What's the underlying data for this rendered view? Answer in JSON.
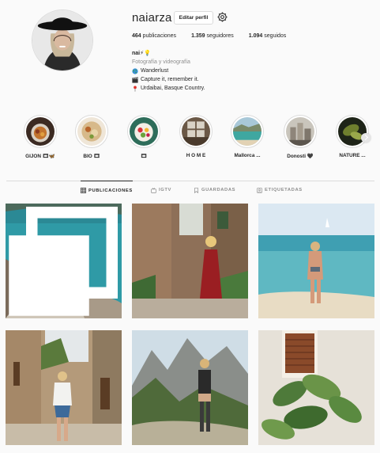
{
  "profile": {
    "username": "naiarza",
    "edit_label": "Editar perfil",
    "stats": {
      "posts_count": "464",
      "posts_label": "publicaciones",
      "followers_count": "1.359",
      "followers_label": "seguidores",
      "following_count": "1.094",
      "following_label": "seguidos"
    },
    "bio": {
      "name": "nai⚡💡",
      "category": "Fotografía y videografía",
      "line1": "Wanderlust",
      "line2": "Capture it, remember it.",
      "line3": "Urdaibai, Basque Country."
    }
  },
  "highlights": [
    {
      "label": "GIJON 🎞🦋",
      "icon": "food-photo"
    },
    {
      "label": "BIO 🎞",
      "icon": "bowl-photo"
    },
    {
      "label": "🎞",
      "icon": "fruit-bowl-photo"
    },
    {
      "label": "H O M E",
      "icon": "window-photo"
    },
    {
      "label": "Mallorca ...",
      "icon": "beach-photo"
    },
    {
      "label": "Donosti 🖤",
      "icon": "city-photo"
    },
    {
      "label": "NATURE ...",
      "icon": "leaf-photo"
    }
  ],
  "tabs": [
    {
      "label": "PUBLICACIONES",
      "icon": "grid-icon",
      "active": true
    },
    {
      "label": "IGTV",
      "icon": "igtv-icon"
    },
    {
      "label": "GUARDADAS",
      "icon": "bookmark-icon"
    },
    {
      "label": "ETIQUETADAS",
      "icon": "tagged-icon"
    }
  ],
  "posts": [
    {
      "subject": "woman on rocks by turquoise sea",
      "multi": true
    },
    {
      "subject": "woman in red dress on stone street"
    },
    {
      "subject": "woman walking on beach"
    },
    {
      "subject": "woman walking in village street"
    },
    {
      "subject": "woman hiking in mountains"
    },
    {
      "subject": "green plant by shuttered window"
    }
  ],
  "colors": {
    "text": "#262626",
    "muted": "#8e8e8e",
    "border": "#dbdbdb",
    "background": "#fafafa"
  }
}
